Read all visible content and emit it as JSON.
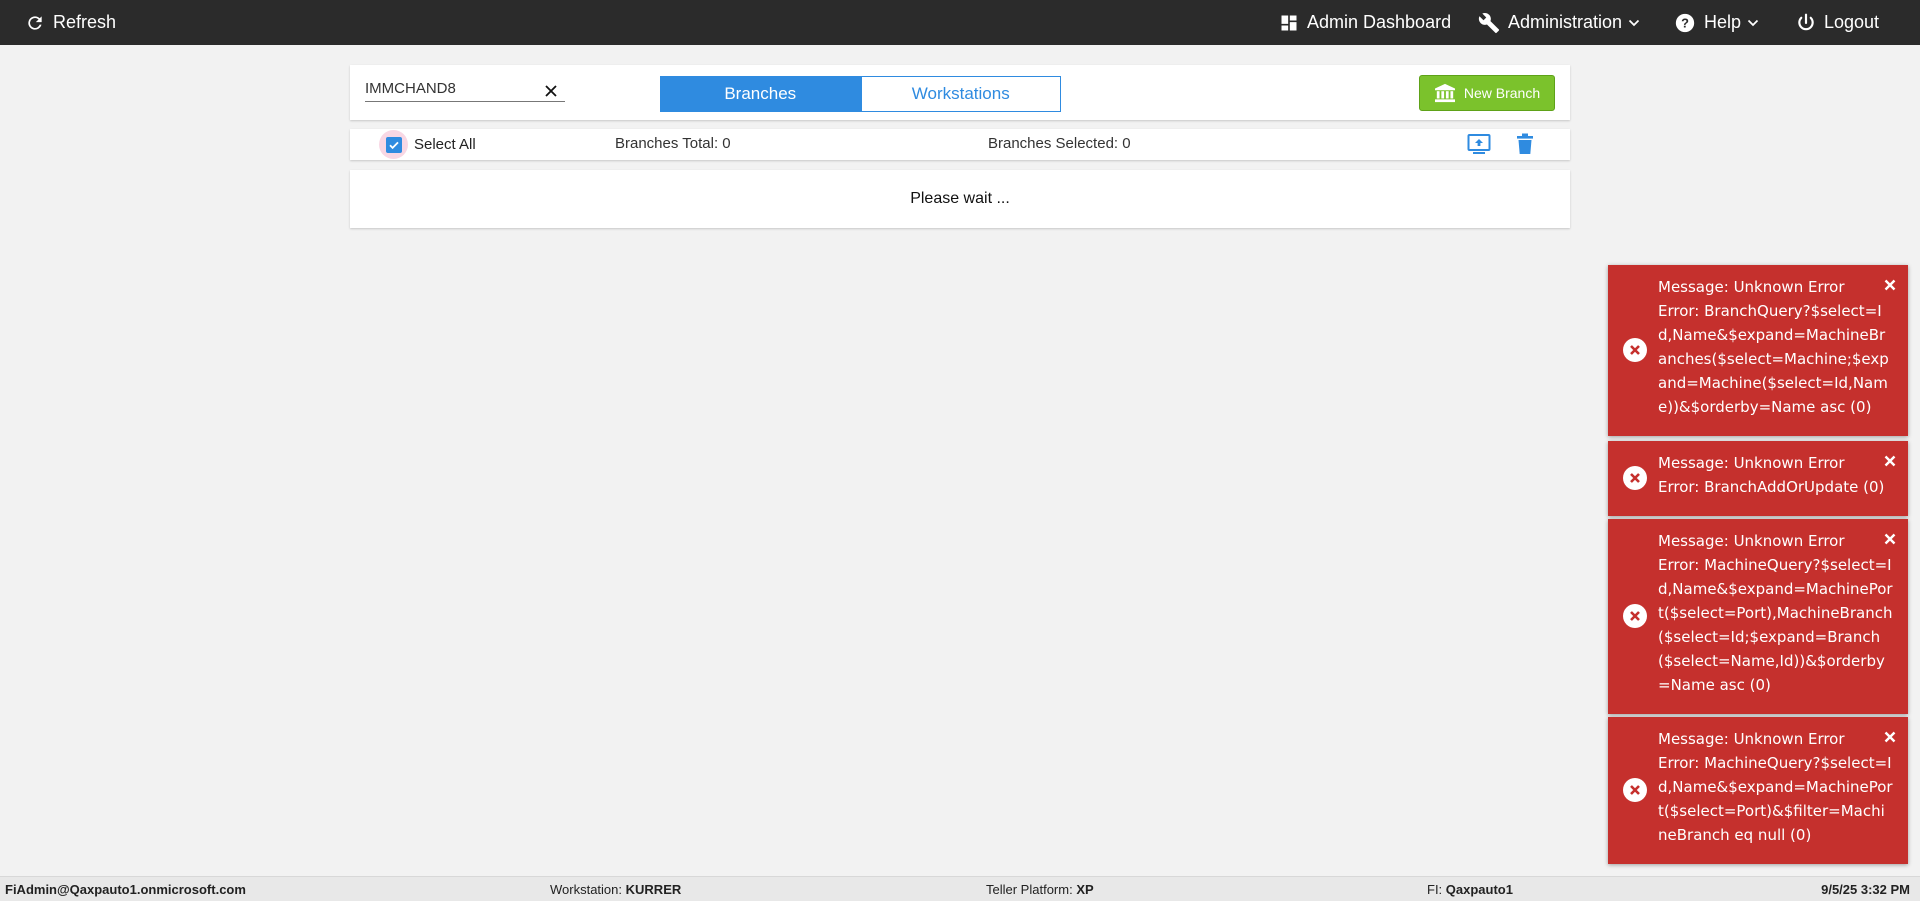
{
  "topbar": {
    "refresh_label": "Refresh",
    "admin_dashboard_label": "Admin Dashboard",
    "administration_label": "Administration",
    "help_label": "Help",
    "logout_label": "Logout"
  },
  "search": {
    "value": "IMMCHAND8"
  },
  "tabs": [
    {
      "label": "Branches",
      "active": true
    },
    {
      "label": "Workstations",
      "active": false
    }
  ],
  "new_branch_label": "New Branch",
  "select_bar": {
    "select_all_label": "Select All",
    "select_all_checked": true,
    "branches_total": "Branches Total: 0",
    "branches_selected": "Branches Selected: 0"
  },
  "wait_text": "Please wait ...",
  "toasts": [
    {
      "message": "Message: Unknown Error",
      "error": "Error: BranchQuery?$select=Id,Name&$expand=MachineBranches($select=Machine;$expand=Machine($select=Id,Name))&$orderby=Name asc (0)"
    },
    {
      "message": "Message: Unknown Error",
      "error": "Error: BranchAddOrUpdate (0)"
    },
    {
      "message": "Message: Unknown Error",
      "error": "Error: MachineQuery?$select=Id,Name&$expand=MachinePort($select=Port),MachineBranch($select=Id;$expand=Branch($select=Name,Id))&$orderby=Name asc (0)"
    },
    {
      "message": "Message: Unknown Error",
      "error": "Error: MachineQuery?$select=Id,Name&$expand=MachinePort($select=Port)&$filter=MachineBranch eq null (0)"
    }
  ],
  "statusbar": {
    "user": "FiAdmin@Qaxpauto1.onmicrosoft.com",
    "workstation_label": "Workstation:",
    "workstation_value": "KURRER",
    "platform_label": "Teller Platform:",
    "platform_value": "XP",
    "fi_label": "FI:",
    "fi_value": "Qaxpauto1",
    "datetime": "9/5/25 3:32 PM"
  },
  "colors": {
    "topbar": "#2b2b2b",
    "accent": "#2f8be0",
    "new_branch": "#7bc22c",
    "toast_error": "#c5302d"
  },
  "icons": [
    "refresh-icon",
    "dashboard-icon",
    "wrench-icon",
    "help-icon",
    "power-icon",
    "chevron-down-icon",
    "clear-icon",
    "bank-icon",
    "checkbox-icon",
    "upload-icon",
    "trash-icon",
    "error-icon",
    "close-icon"
  ]
}
